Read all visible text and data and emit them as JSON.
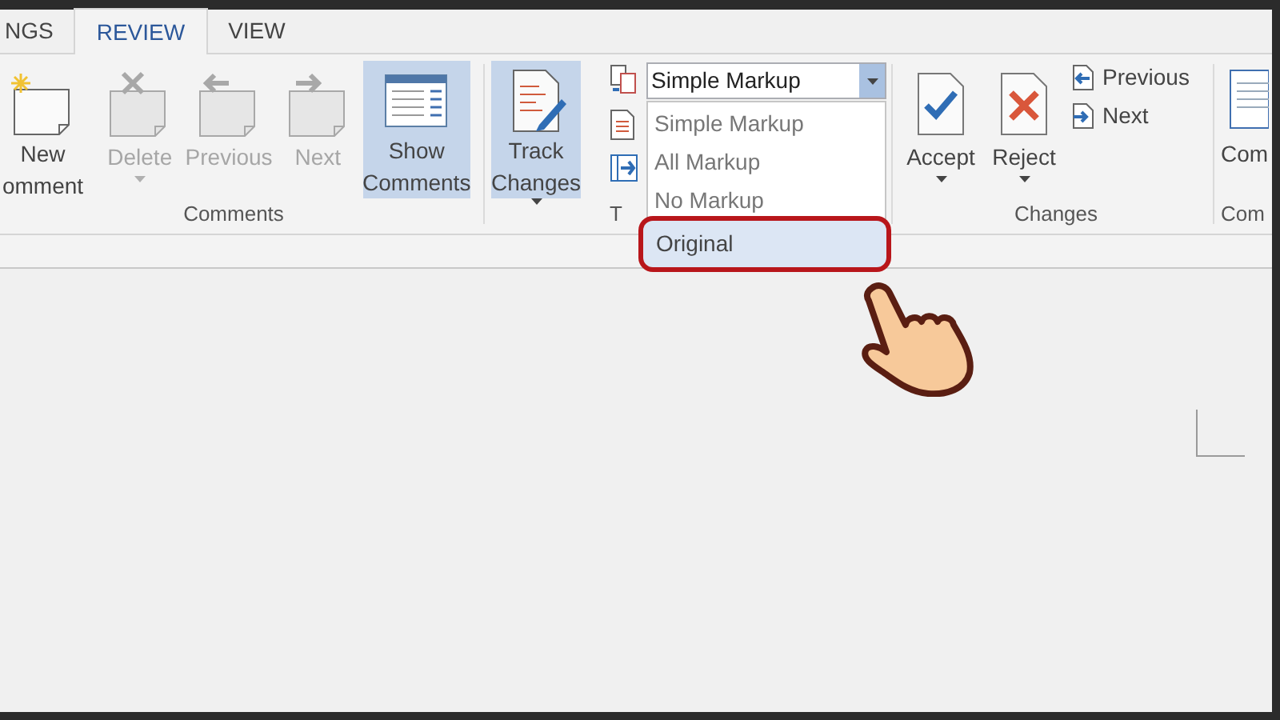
{
  "tabs": [
    {
      "label": "NGS",
      "selected": false
    },
    {
      "label": "REVIEW",
      "selected": true
    },
    {
      "label": "VIEW",
      "selected": false
    }
  ],
  "comments_group": {
    "label": "Comments",
    "buttons": [
      {
        "lines": [
          "New",
          "omment"
        ],
        "disabled": false,
        "selected": false
      },
      {
        "lines": [
          "Delete"
        ],
        "disabled": true,
        "selected": false,
        "caret": true
      },
      {
        "lines": [
          "Previous"
        ],
        "disabled": true,
        "selected": false
      },
      {
        "lines": [
          "Next"
        ],
        "disabled": true,
        "selected": false
      },
      {
        "lines": [
          "Show",
          "Comments"
        ],
        "disabled": false,
        "selected": true
      }
    ]
  },
  "tracking_group": {
    "label": "T",
    "track_changes": {
      "lines": [
        "Track",
        "Changes"
      ],
      "selected": true,
      "caret": true
    },
    "markup_dropdown": {
      "value": "Simple Markup",
      "expanded": true,
      "options": [
        {
          "label": "Simple Markup",
          "highlighted": false
        },
        {
          "label": "All Markup",
          "highlighted": false
        },
        {
          "label": "No Markup",
          "highlighted": false
        },
        {
          "label": "Original",
          "highlighted": true
        }
      ]
    }
  },
  "changes_group": {
    "label": "Changes",
    "accept": {
      "label": "Accept",
      "caret": true
    },
    "reject": {
      "label": "Reject",
      "caret": true
    },
    "previous": "Previous",
    "next": "Next"
  },
  "compare_group": {
    "button": "Com",
    "label": "Com"
  }
}
